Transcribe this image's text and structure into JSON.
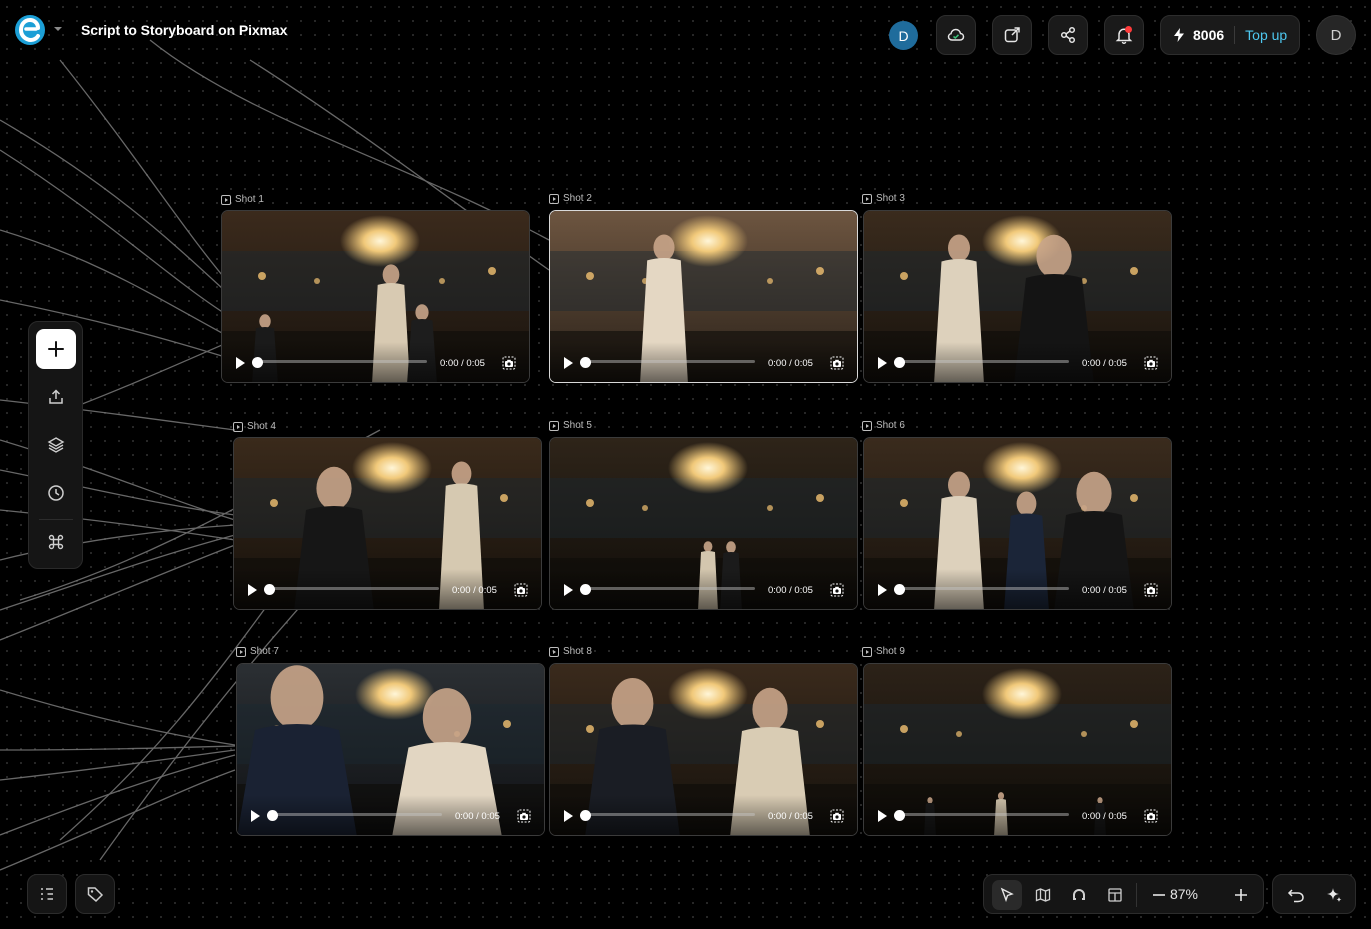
{
  "header": {
    "title": "Script to Storyboard on Pixmax",
    "avatar_initial": "D",
    "credits": "8006",
    "topup_label": "Top up",
    "user_initial": "D",
    "icons": [
      "cloud-sync-icon",
      "open-external-icon",
      "share-icon",
      "bell-icon"
    ]
  },
  "left_toolbar": {
    "icons": [
      "plus-icon",
      "upload-icon",
      "layers-icon",
      "history-icon",
      "command-icon"
    ]
  },
  "shots": [
    {
      "label": "Shot 1",
      "time": "0:00 / 0:05",
      "scene": "woman-center",
      "selected": false
    },
    {
      "label": "Shot 2",
      "time": "0:00 / 0:05",
      "scene": "woman-left-bright",
      "selected": true
    },
    {
      "label": "Shot 3",
      "time": "0:00 / 0:05",
      "scene": "woman-and-man-talking",
      "selected": false
    },
    {
      "label": "Shot 4",
      "time": "0:00 / 0:05",
      "scene": "man-pointing-woman",
      "selected": false
    },
    {
      "label": "Shot 5",
      "time": "0:00 / 0:05",
      "scene": "wide-ballroom-couple",
      "selected": false
    },
    {
      "label": "Shot 6",
      "time": "0:00 / 0:05",
      "scene": "handshake-three",
      "selected": false
    },
    {
      "label": "Shot 7",
      "time": "0:00 / 0:05",
      "scene": "closeup-couple-dark",
      "selected": false
    },
    {
      "label": "Shot 8",
      "time": "0:00 / 0:05",
      "scene": "couple-facing",
      "selected": false
    },
    {
      "label": "Shot 9",
      "time": "0:00 / 0:05",
      "scene": "wide-ballroom-empty",
      "selected": false
    }
  ],
  "bottom_left": {
    "icons": [
      "outline-icon",
      "tag-icon"
    ]
  },
  "bottom_right": {
    "icons": [
      "select-pointer-icon",
      "map-icon",
      "magnet-icon",
      "layout-icon",
      "zoom-out-icon",
      "zoom-in-icon",
      "undo-icon",
      "sparkle-icon"
    ],
    "zoom": "87%"
  },
  "colors": {
    "accent": "#4ec8f0",
    "avatar": "#1f6c9c",
    "notification": "#ff3b3b"
  }
}
